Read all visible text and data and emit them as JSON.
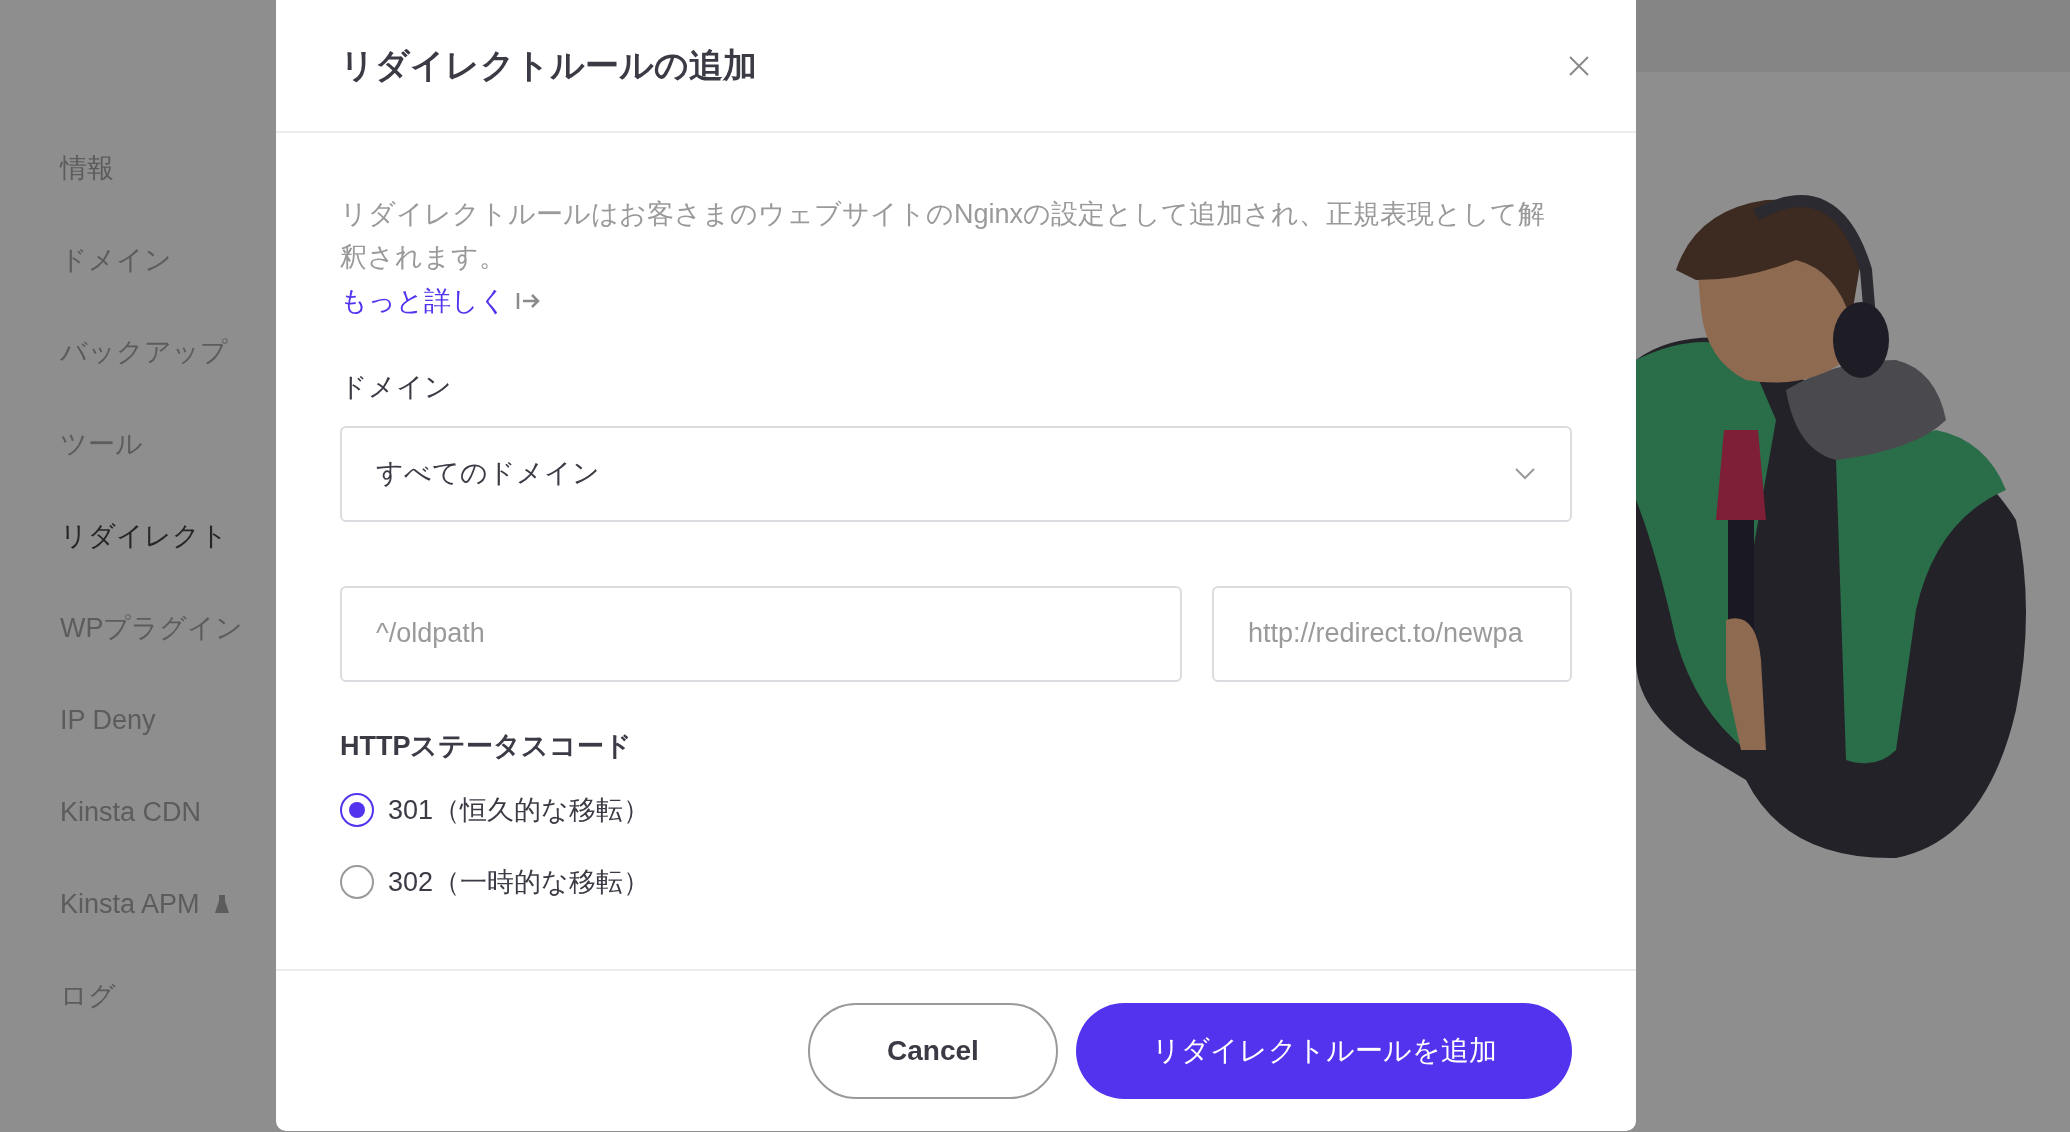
{
  "sidebar": {
    "items": [
      {
        "label": "情報",
        "selected": false,
        "kind": "plain"
      },
      {
        "label": "ドメイン",
        "selected": false,
        "kind": "plain"
      },
      {
        "label": "バックアップ",
        "selected": false,
        "kind": "plain"
      },
      {
        "label": "ツール",
        "selected": false,
        "kind": "plain"
      },
      {
        "label": "リダイレクト",
        "selected": true,
        "kind": "plain"
      },
      {
        "label": "WPプラグイン",
        "selected": false,
        "kind": "plain"
      },
      {
        "label": "IP Deny",
        "selected": false,
        "kind": "plain"
      },
      {
        "label": "Kinsta CDN",
        "selected": false,
        "kind": "plain"
      },
      {
        "label": "Kinsta APM",
        "selected": false,
        "kind": "labs"
      },
      {
        "label": "ログ",
        "selected": false,
        "kind": "plain"
      }
    ]
  },
  "modal": {
    "title": "リダイレクトルールの追加",
    "description": "リダイレクトルールはお客さまのウェブサイトのNginxの設定として追加され、正規表現として解釈されます。",
    "link": "もっと詳しく",
    "domain_label": "ドメイン",
    "domain_select": {
      "value": "すべてのドメイン"
    },
    "source_field": {
      "placeholder": "^/oldpath"
    },
    "target_field": {
      "placeholder": "http://redirect.to/newpa"
    },
    "status_label": "HTTPステータスコード",
    "status_options": [
      {
        "label": "301（恒久的な移転）",
        "selected": true
      },
      {
        "label": "302（一時的な移転）",
        "selected": false
      }
    ],
    "buttons": [
      {
        "label": "Cancel",
        "kind": "secondary"
      },
      {
        "label": "リダイレクトルールを追加",
        "kind": "primary"
      }
    ]
  }
}
